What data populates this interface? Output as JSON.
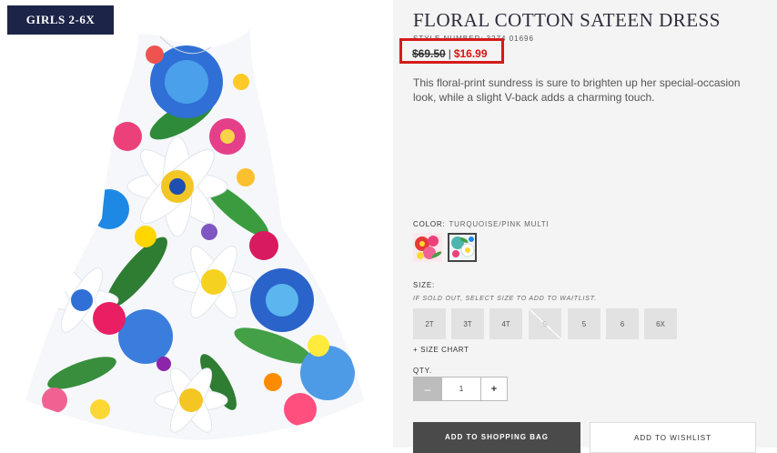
{
  "badge": {
    "label": "GIRLS 2-6X"
  },
  "product": {
    "title": "FLORAL COTTON SATEEN DRESS",
    "style_number": "STYLE NUMBER: 3274 01696",
    "price_original": "$69.50",
    "price_separator": "|",
    "price_sale": "$16.99",
    "description": "This floral-print sundress is sure to brighten up her special-occasion look, while a slight V-back adds a charming touch."
  },
  "color": {
    "label": "COLOR:",
    "selected": "TURQUOISE/PINK MULTI",
    "swatches": [
      {
        "name": "Red/Pink Multi",
        "selected": false
      },
      {
        "name": "Turquoise/Pink Multi",
        "selected": true
      }
    ]
  },
  "size": {
    "label": "SIZE:",
    "waitlist_note": "IF SOLD OUT, SELECT SIZE TO ADD TO WAITLIST.",
    "options": [
      {
        "label": "2T",
        "sold_out": false
      },
      {
        "label": "3T",
        "sold_out": false
      },
      {
        "label": "4T",
        "sold_out": false
      },
      {
        "label": "5",
        "sold_out": true
      },
      {
        "label": "5",
        "sold_out": false
      },
      {
        "label": "6",
        "sold_out": false
      },
      {
        "label": "6X",
        "sold_out": false
      }
    ],
    "chart_link": "+ SIZE CHART"
  },
  "quantity": {
    "label": "QTY.",
    "minus": "–",
    "value": "1",
    "plus": "+"
  },
  "actions": {
    "add_to_bag": "ADD TO SHOPPING BAG",
    "add_to_wishlist": "ADD TO WISHLIST"
  },
  "colors": {
    "badge_bg": "#1c2447",
    "sale_price": "#dd1111",
    "highlight_border": "#d61a1a",
    "primary_button": "#4a4a4a"
  }
}
